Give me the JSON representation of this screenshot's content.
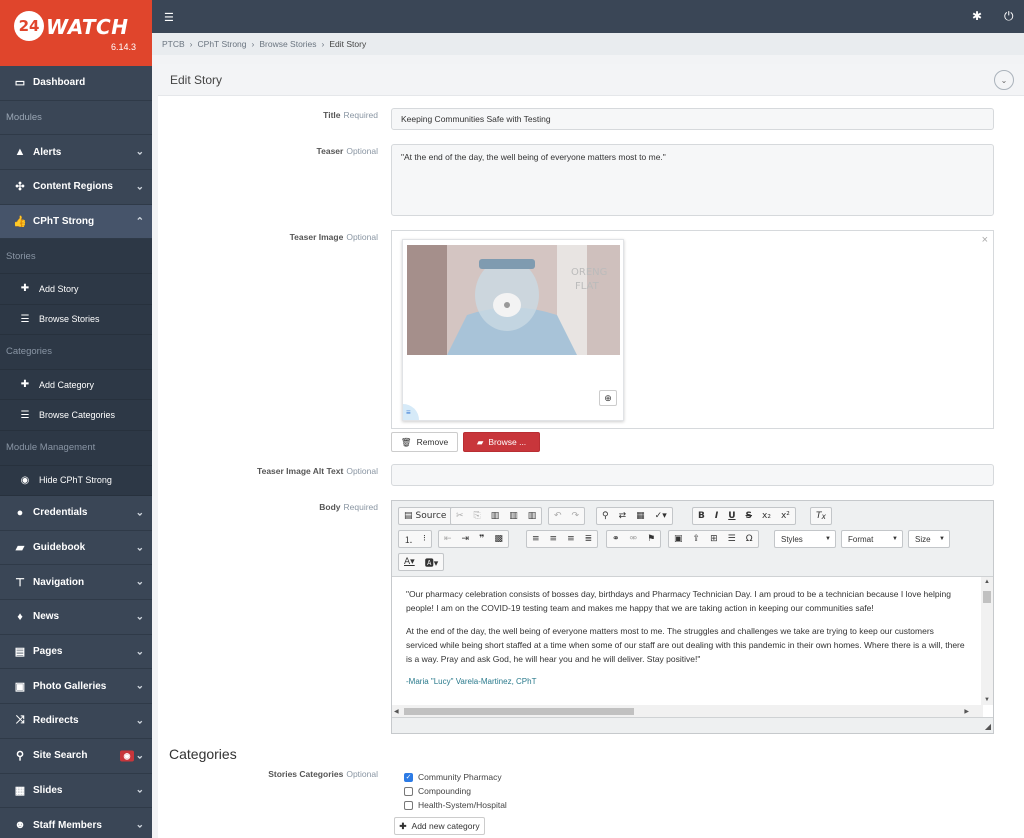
{
  "app": {
    "logo_badge": "24",
    "logo_text": "WATCH",
    "version": "6.14.3"
  },
  "sidebar": {
    "dashboard": "Dashboard",
    "modules_heading": "Modules",
    "alerts": "Alerts",
    "content_regions": "Content Regions",
    "cpht_strong": "CPhT Strong",
    "stories_heading": "Stories",
    "add_story": "Add Story",
    "browse_stories": "Browse Stories",
    "categories_heading": "Categories",
    "add_category": "Add Category",
    "browse_categories": "Browse Categories",
    "module_mgmt_heading": "Module Management",
    "hide_cpht": "Hide CPhT Strong",
    "credentials": "Credentials",
    "guidebook": "Guidebook",
    "navigation": "Navigation",
    "news": "News",
    "pages": "Pages",
    "photo_galleries": "Photo Galleries",
    "redirects": "Redirects",
    "site_search": "Site Search",
    "slides": "Slides",
    "staff_members": "Staff Members"
  },
  "breadcrumb": {
    "b1": "PTCB",
    "b2": "CPhT Strong",
    "b3": "Browse Stories",
    "b4": "Edit Story"
  },
  "panel": {
    "title": "Edit Story"
  },
  "form": {
    "title_label": "Title",
    "title_hint": "Required",
    "title_value": "Keeping Communities Safe with Testing",
    "teaser_label": "Teaser",
    "teaser_hint": "Optional",
    "teaser_value": "\"At the end of the day, the well being of everyone matters most to me.\"",
    "image_label": "Teaser Image",
    "image_hint": "Optional",
    "remove_label": "Remove",
    "browse_label": "Browse ...",
    "alt_label": "Teaser Image Alt Text",
    "alt_hint": "Optional",
    "body_label": "Body",
    "body_hint": "Required"
  },
  "editor": {
    "source": "Source",
    "styles": "Styles",
    "format": "Format",
    "size": "Size",
    "p1": "\"Our pharmacy celebration consists of bosses day, birthdays and Pharmacy Technician Day. I am proud to be a technician because I love helping people! I am on the COVID-19 testing team and makes me happy that we are taking action in keeping our communities safe!",
    "p2": "At the end of the day, the well being of everyone matters most to me. The struggles and challenges we take are trying to keep our customers serviced while being short staffed at a time when some of our staff are out dealing with this pandemic in their own homes. Where there is a will, there is a way. Pray and ask God, he will hear you and he will deliver. Stay positive!\"",
    "sig": "-Maria \"Lucy\" Varela-Martinez, CPhT"
  },
  "categories": {
    "heading": "Categories",
    "label": "Stories Categories",
    "hint": "Optional",
    "items": [
      {
        "name": "Community Pharmacy",
        "checked": true
      },
      {
        "name": "Compounding",
        "checked": false
      },
      {
        "name": "Health-System/Hospital",
        "checked": false
      }
    ],
    "add_label": "Add new category"
  }
}
